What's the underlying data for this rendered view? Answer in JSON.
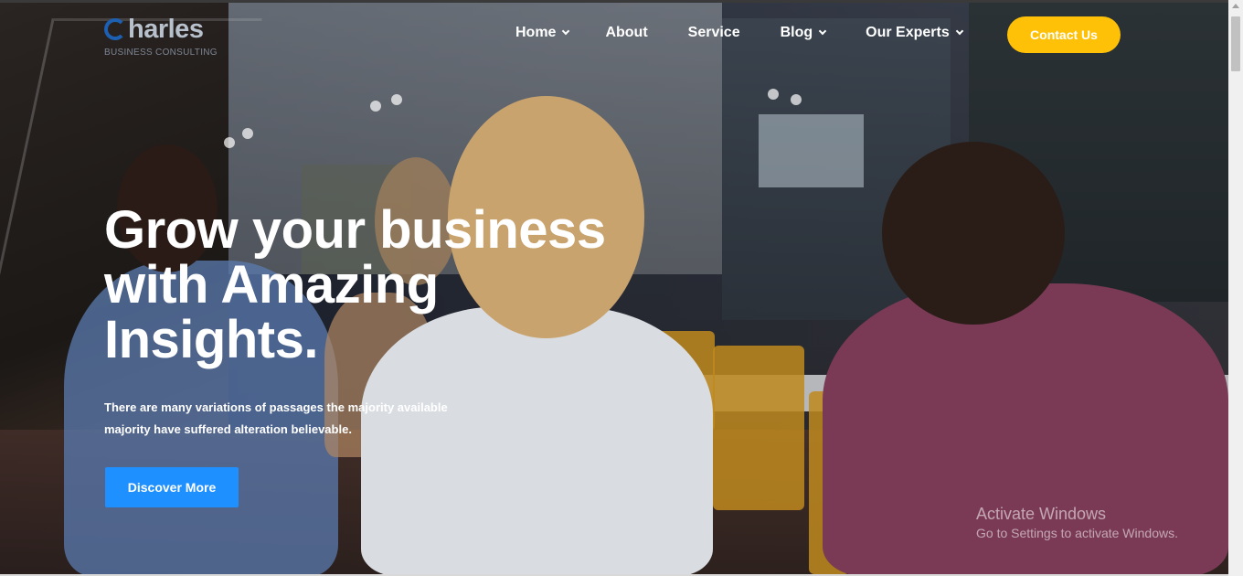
{
  "brand": {
    "name": "harles",
    "tagline": "BUSINESS CONSULTING"
  },
  "nav": {
    "items": [
      {
        "label": "Home",
        "has_dropdown": true
      },
      {
        "label": "About",
        "has_dropdown": false
      },
      {
        "label": "Service",
        "has_dropdown": false
      },
      {
        "label": "Blog",
        "has_dropdown": true
      },
      {
        "label": "Our Experts",
        "has_dropdown": true
      }
    ],
    "cta_label": "Contact Us"
  },
  "hero": {
    "headline_line1": "Grow your business",
    "headline_line2": "with Amazing",
    "headline_line3": "Insights.",
    "subtext_line1": "There are many variations of passages the majority available",
    "subtext_line2": "majority have suffered alteration believable.",
    "button_label": "Discover More"
  },
  "watermark": {
    "title": "Activate Windows",
    "subtitle": "Go to Settings to activate Windows."
  },
  "colors": {
    "accent_yellow": "#ffc107",
    "accent_blue": "#1e90ff",
    "logo_blue": "#1d5fb0"
  },
  "icons": {
    "dropdown": "chevron-down-icon",
    "logo": "logo-c-icon"
  }
}
